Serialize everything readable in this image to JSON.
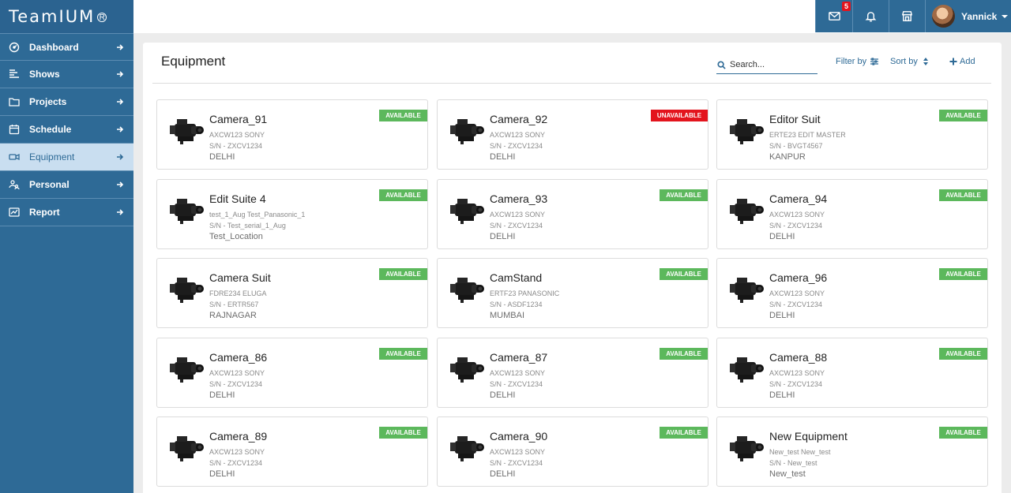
{
  "app": {
    "logo": "TeamIUM"
  },
  "sidebar": {
    "items": [
      {
        "label": "Dashboard",
        "icon": "gauge-icon"
      },
      {
        "label": "Shows",
        "icon": "bars-icon"
      },
      {
        "label": "Projects",
        "icon": "folder-icon"
      },
      {
        "label": "Schedule",
        "icon": "calendar-icon"
      },
      {
        "label": "Equipment",
        "icon": "video-camera-icon",
        "active": true
      },
      {
        "label": "Personal",
        "icon": "people-icon"
      },
      {
        "label": "Report",
        "icon": "chart-icon"
      }
    ]
  },
  "topbar": {
    "mail_count": "5",
    "user_name": "Yannick"
  },
  "main": {
    "title": "Equipment",
    "search_placeholder": "Search...",
    "filter_label": "Filter by",
    "sort_label": "Sort by",
    "add_label": "Add"
  },
  "equipment": [
    {
      "name": "Camera_91",
      "model": "AXCW123 SONY",
      "serial": "S/N - ZXCV1234",
      "location": "DELHI",
      "status": "AVAILABLE"
    },
    {
      "name": "Camera_92",
      "model": "AXCW123 SONY",
      "serial": "S/N - ZXCV1234",
      "location": "DELHI",
      "status": "UNAVAILABLE"
    },
    {
      "name": "Editor Suit",
      "model": "ERTE23 EDIT MASTER",
      "serial": "S/N - BVGT4567",
      "location": "KANPUR",
      "status": "AVAILABLE"
    },
    {
      "name": "Edit Suite 4",
      "model": "test_1_Aug Test_Panasonic_1",
      "serial": "S/N - Test_serial_1_Aug",
      "location": "Test_Location",
      "status": "AVAILABLE"
    },
    {
      "name": "Camera_93",
      "model": "AXCW123 SONY",
      "serial": "S/N - ZXCV1234",
      "location": "DELHI",
      "status": "AVAILABLE"
    },
    {
      "name": "Camera_94",
      "model": "AXCW123 SONY",
      "serial": "S/N - ZXCV1234",
      "location": "DELHI",
      "status": "AVAILABLE"
    },
    {
      "name": "Camera Suit",
      "model": "FDRE234 ELUGA",
      "serial": "S/N - ERTR567",
      "location": "RAJNAGAR",
      "status": "AVAILABLE"
    },
    {
      "name": "CamStand",
      "model": "ERTF23 PANASONIC",
      "serial": "S/N - ASDF1234",
      "location": "MUMBAI",
      "status": "AVAILABLE"
    },
    {
      "name": "Camera_96",
      "model": "AXCW123 SONY",
      "serial": "S/N - ZXCV1234",
      "location": "DELHI",
      "status": "AVAILABLE"
    },
    {
      "name": "Camera_86",
      "model": "AXCW123 SONY",
      "serial": "S/N - ZXCV1234",
      "location": "DELHI",
      "status": "AVAILABLE"
    },
    {
      "name": "Camera_87",
      "model": "AXCW123 SONY",
      "serial": "S/N - ZXCV1234",
      "location": "DELHI",
      "status": "AVAILABLE"
    },
    {
      "name": "Camera_88",
      "model": "AXCW123 SONY",
      "serial": "S/N - ZXCV1234",
      "location": "DELHI",
      "status": "AVAILABLE"
    },
    {
      "name": "Camera_89",
      "model": "AXCW123 SONY",
      "serial": "S/N - ZXCV1234",
      "location": "DELHI",
      "status": "AVAILABLE"
    },
    {
      "name": "Camera_90",
      "model": "AXCW123 SONY",
      "serial": "S/N - ZXCV1234",
      "location": "DELHI",
      "status": "AVAILABLE"
    },
    {
      "name": "New Equipment",
      "model": "New_test New_test",
      "serial": "S/N - New_test",
      "location": "New_test",
      "status": "AVAILABLE"
    }
  ],
  "colors": {
    "sidebar": "#2e6a96",
    "active_item": "#c9def0",
    "available": "#5cb85c",
    "unavailable": "#e3141d"
  }
}
